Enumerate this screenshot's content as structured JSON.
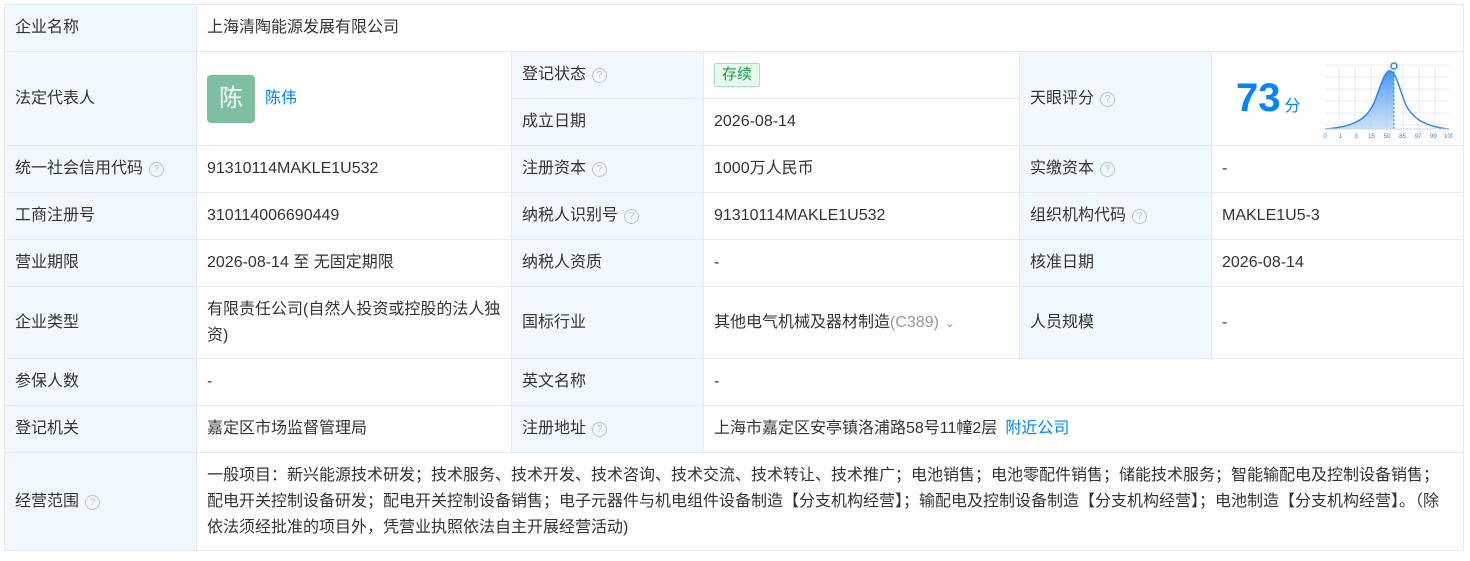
{
  "company_name_label": "企业名称",
  "company_name": "上海清陶能源发展有限公司",
  "legal_rep": {
    "label": "法定代表人",
    "avatar_char": "陈",
    "name": "陈伟"
  },
  "reg_status": {
    "label": "登记状态",
    "value": "存续"
  },
  "founded": {
    "label": "成立日期",
    "value": "2026-08-14"
  },
  "tianyan": {
    "label": "天眼评分",
    "score": "73",
    "unit": "分",
    "chart_ticks": [
      "0",
      "1",
      "3",
      "15",
      "50",
      "85",
      "97",
      "99",
      "100"
    ],
    "marker_fraction": 0.73
  },
  "credit_code": {
    "label": "统一社会信用代码",
    "value": "91310114MAKLE1U532"
  },
  "reg_capital": {
    "label": "注册资本",
    "value": "1000万人民币"
  },
  "paid_capital": {
    "label": "实缴资本",
    "value": "-"
  },
  "biz_reg_no": {
    "label": "工商注册号",
    "value": "310114006690449"
  },
  "taxpayer_id": {
    "label": "纳税人识别号",
    "value": "91310114MAKLE1U532"
  },
  "org_code": {
    "label": "组织机构代码",
    "value": "MAKLE1U5-3"
  },
  "biz_term": {
    "label": "营业期限",
    "value": "2026-08-14 至 无固定期限"
  },
  "taxpayer_qual": {
    "label": "纳税人资质",
    "value": "-"
  },
  "approval_date": {
    "label": "核准日期",
    "value": "2026-08-14"
  },
  "company_type": {
    "label": "企业类型",
    "value": "有限责任公司(自然人投资或控股的法人独资)"
  },
  "industry": {
    "label": "国标行业",
    "value": "其他电气机械及器材制造",
    "code": "(C389)"
  },
  "staff_size": {
    "label": "人员规模",
    "value": "-"
  },
  "insured": {
    "label": "参保人数",
    "value": "-"
  },
  "english_name": {
    "label": "英文名称",
    "value": "-"
  },
  "reg_authority": {
    "label": "登记机关",
    "value": "嘉定区市场监督管理局"
  },
  "reg_address": {
    "label": "注册地址",
    "value": "上海市嘉定区安亭镇洛浦路58号11幢2层",
    "nearby": "附近公司"
  },
  "biz_scope": {
    "label": "经营范围",
    "value": "一般项目：新兴能源技术研发；技术服务、技术开发、技术咨询、技术交流、技术转让、技术推广；电池销售；电池零配件销售；储能技术服务；智能输配电及控制设备销售；配电开关控制设备研发；配电开关控制设备销售；电子元器件与机电组件设备制造【分支机构经营】；输配电及控制设备制造【分支机构经营】；电池制造【分支机构经营】。（除依法须经批准的项目外，凭营业执照依法自主开展经营活动)"
  },
  "help_glyph": "?",
  "chevron_glyph": "⌄",
  "colors": {
    "label_bg": "#f2f8ff",
    "border": "#e4eaf2",
    "link": "#0084ff",
    "status_green": "#11a34a",
    "avatar_bg": "#7dbf9e"
  }
}
